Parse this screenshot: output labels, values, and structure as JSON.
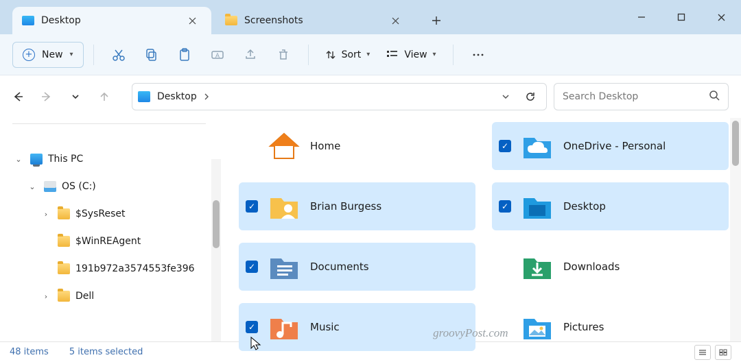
{
  "tabs": [
    {
      "label": "Desktop",
      "active": true,
      "icon": "desktop"
    },
    {
      "label": "Screenshots",
      "active": false,
      "icon": "folder"
    }
  ],
  "toolbar": {
    "new_label": "New",
    "sort_label": "Sort",
    "view_label": "View"
  },
  "address": {
    "crumb": "Desktop"
  },
  "search": {
    "placeholder": "Search Desktop"
  },
  "tree": {
    "this_pc": "This PC",
    "os": "OS (C:)",
    "sysreset": "$SysReset",
    "winre": "$WinREAgent",
    "longfolder": "191b972a3574553fe396",
    "dell": "Dell"
  },
  "items": {
    "home": "Home",
    "brian": "Brian Burgess",
    "documents": "Documents",
    "music": "Music",
    "onedrive": "OneDrive - Personal",
    "desktop": "Desktop",
    "downloads": "Downloads",
    "pictures": "Pictures"
  },
  "status": {
    "count": "48 items",
    "selected": "5 items selected"
  },
  "watermark": "groovyPost.com"
}
